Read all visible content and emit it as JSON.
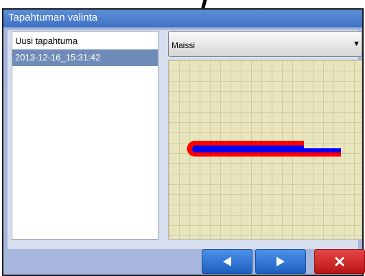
{
  "window": {
    "title": "Tapahtuman valinta"
  },
  "event_list": {
    "items": [
      {
        "label": "Uusi tapahtuma",
        "selected": false
      },
      {
        "label": "2013-12-16_15:31:42",
        "selected": true
      }
    ]
  },
  "crop_dropdown": {
    "value": "Maissi",
    "icon": "triangle-down-icon"
  },
  "buttons": {
    "back": {
      "icon": "left-arrow-icon"
    },
    "next": {
      "icon": "right-arrow-icon"
    },
    "close": {
      "icon": "close-x-icon"
    }
  },
  "colors": {
    "title_bar": "#4a7fd0",
    "selection": "#6f8cb8",
    "field_grid": "#e8e5bc",
    "path_outline": "#ff0000",
    "path_fill": "#0000ff",
    "nav_button": "#2f78d8",
    "close_button": "#d42b2b"
  }
}
